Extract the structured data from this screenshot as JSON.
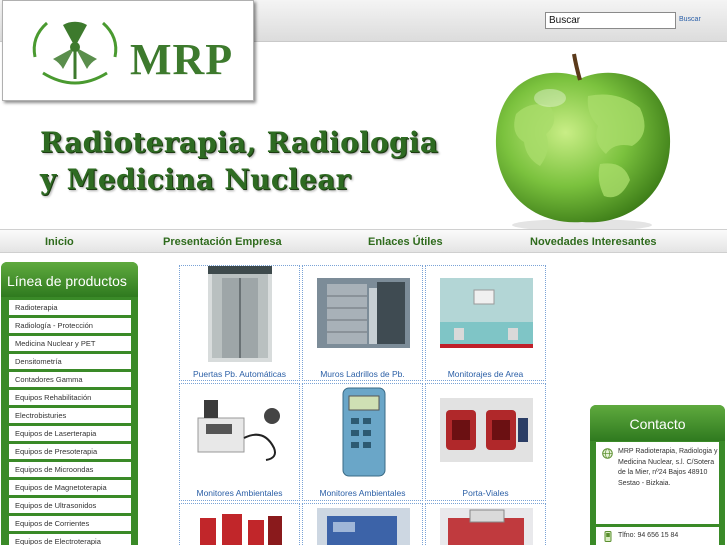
{
  "header": {
    "search_value": "Buscar",
    "search_link": "Buscar",
    "logo_text": "MRP",
    "title_line1": "Radioterapia, Radiologia",
    "title_line2": "y Medicina Nuclear"
  },
  "nav": {
    "items": [
      "Inicio",
      "Presentación Empresa",
      "Enlaces Útiles",
      "Novedades Interesantes"
    ]
  },
  "sidebar": {
    "heading": "Línea de productos",
    "items": [
      "Radioterapia",
      "Radiología - Protección",
      "Medicina Nuclear y PET",
      "Densitometría",
      "Contadores Gamma",
      "Equipos Rehabilitación",
      "Electrobisturies",
      "Equipos de Laserterapia",
      "Equipos de Presoterapia",
      "Equipos de Microondas",
      "Equipos de Magnetoterapia",
      "Equipos de Ultrasonidos",
      "Equipos de Corrientes",
      "Equipos de Electroterapia"
    ]
  },
  "products": [
    {
      "label": "Puertas Pb. Automáticas",
      "icon": "elevator-door-photo"
    },
    {
      "label": "Muros Ladrillos de Pb.",
      "icon": "lead-brick-wall-photo"
    },
    {
      "label": "Monitorajes de Area",
      "icon": "area-monitor-photo"
    },
    {
      "label": "Monitores Ambientales",
      "icon": "ambient-monitor-photo"
    },
    {
      "label": "Monitores Ambientales",
      "icon": "handheld-monitor-photo"
    },
    {
      "label": "Porta-Viales",
      "icon": "vial-holder-photo"
    },
    {
      "label": "",
      "icon": "red-containers-photo"
    },
    {
      "label": "",
      "icon": "equipment-photo"
    },
    {
      "label": "",
      "icon": "lab-instrument-photo"
    }
  ],
  "contact": {
    "heading": "Contacto",
    "address": "MRP Radioterapia, Radiologia y Medicina Nuclear, s.l. C/Sotera de la Mier, nº24 Bajos 48910 Sestao - Bizkaia.",
    "phone": "Tlfno: 94 656 15 84"
  },
  "colors": {
    "brand_green": "#2e6b22",
    "link_blue": "#2b5fa6"
  }
}
